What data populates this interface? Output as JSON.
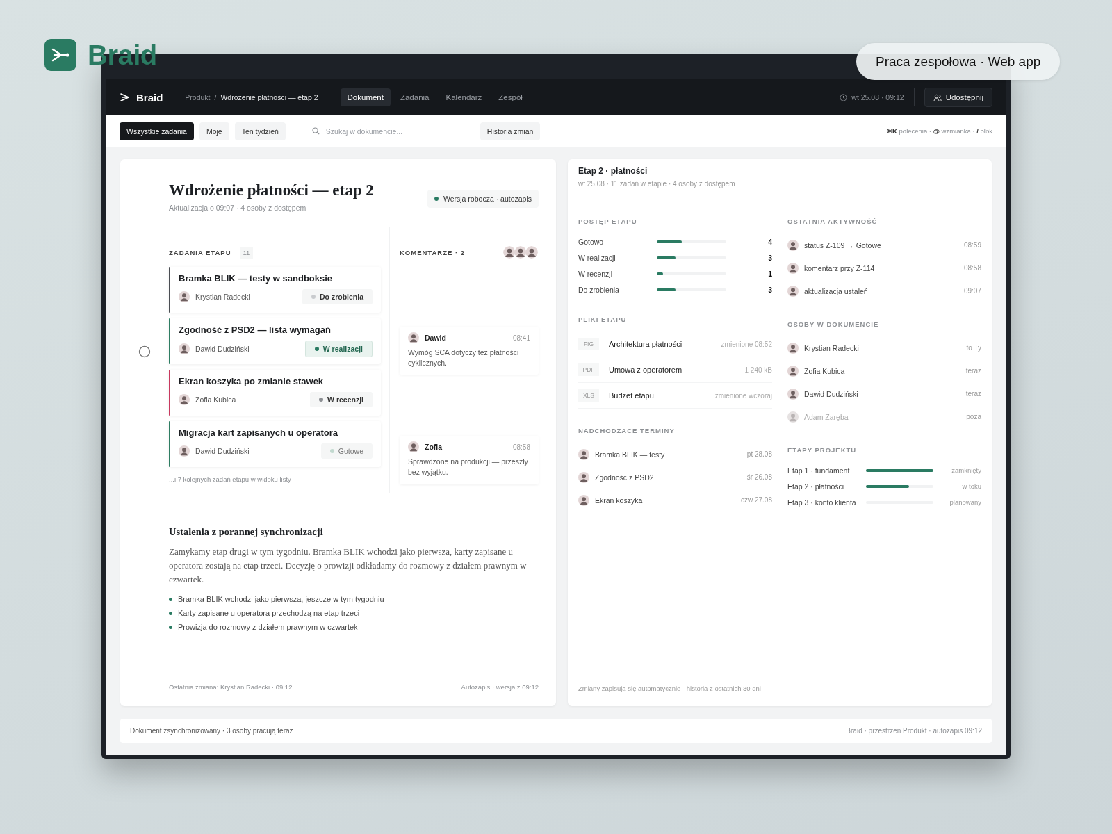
{
  "brand": {
    "name": "Braid"
  },
  "badge": "Praca zespołowa · Web app",
  "nav": {
    "logo": "Braid",
    "breadcrumb": [
      "Produkt",
      "Wdrożenie płatności — etap 2"
    ],
    "breadcrumb_separator": "/",
    "tabs": [
      {
        "label": "Dokument",
        "selected": true
      },
      {
        "label": "Zadania",
        "selected": false
      },
      {
        "label": "Kalendarz",
        "selected": false
      },
      {
        "label": "Zespół",
        "selected": false
      }
    ],
    "datetime": "wt 25.08 · 09:12",
    "share_button": "Udostępnij"
  },
  "toolbar": {
    "filters": [
      {
        "label": "Wszystkie zadania",
        "selected": true
      },
      {
        "label": "Moje",
        "selected": false
      },
      {
        "label": "Ten tydzień",
        "selected": false
      }
    ],
    "search": {
      "placeholder": "Szukaj w dokumencie..."
    },
    "history_button": "Historia zmian",
    "shortcuts": "**⌘K** polecenia · **@** wzmianka · **/** blok"
  },
  "document": {
    "title": "Wdrożenie płatności — etap 2",
    "meta": "Aktualizacja o 09:07 · 4 osoby z dostępem",
    "status": "Wersja robocza · autozapis",
    "tasks_heading": "ZADANIA ETAPU",
    "tasks_count": "11",
    "tasks": [
      {
        "title": "Bramka BLIK — testy w sandboksie",
        "assignee": "Krystian Radecki",
        "color": "#4a4d52",
        "status": {
          "label": "Do zrobienia",
          "kind": "todo"
        }
      },
      {
        "title": "Zgodność z PSD2 — lista wymagań",
        "assignee": "Dawid Dudziński",
        "color": "#2e7d62",
        "status": {
          "label": "W realizacji",
          "kind": "progress"
        }
      },
      {
        "title": "Ekran koszyka po zmianie stawek",
        "assignee": "Zofia Kubica",
        "color": "#c8385e",
        "status": {
          "label": "W recenzji",
          "kind": "review"
        }
      },
      {
        "title": "Migracja kart zapisanych u operatora",
        "assignee": "Dawid Dudziński",
        "color": "#2e7d62",
        "status": {
          "label": "Gotowe",
          "kind": "done"
        }
      }
    ],
    "tasks_more": "...i 7 kolejnych zadań etapu w widoku listy",
    "comments_heading": "KOMENTARZE · 2",
    "comments": [
      {
        "author": "Dawid",
        "time": "08:41",
        "text": "Wymóg SCA dotyczy też płatności cyklicznych."
      },
      {
        "author": "Zofia",
        "time": "08:58",
        "text": "Sprawdzone na produkcji — przeszły bez wyjątku."
      }
    ],
    "notes_heading": "Ustalenia z porannej synchronizacji",
    "notes_text": "Zamykamy etap drugi w tym tygodniu. Bramka BLIK wchodzi jako pierwsza, karty zapisane u operatora zostają na etap trzeci. Decyzję o prowizji odkładamy do rozmowy z działem prawnym w czwartek.",
    "notes_bullets": [
      "Bramka BLIK wchodzi jako pierwsza, jeszcze w tym tygodniu",
      "Karty zapisane u operatora przechodzą na etap trzeci",
      "Prowizja do rozmowy z działem prawnym w czwartek"
    ],
    "footer_left": "Ostatnia zmiana: Krystian Radecki · 09:12",
    "footer_right": "Autozapis · wersja z 09:12"
  },
  "panel": {
    "title": "Etap 2 · płatności",
    "meta": "wt 25.08 · 11 zadań w etapie · 4 osoby z dostępem",
    "progress_heading": "POSTĘP ETAPU",
    "progress": [
      {
        "label": "Gotowo",
        "level": 0.36,
        "count": "4"
      },
      {
        "label": "W realizacji",
        "level": 0.27,
        "count": "3"
      },
      {
        "label": "W recenzji",
        "level": 0.09,
        "count": "1"
      },
      {
        "label": "Do zrobienia",
        "level": 0.27,
        "count": "3"
      }
    ],
    "files_heading": "PLIKI ETAPU",
    "files": [
      {
        "type": "FIG",
        "name": "Architektura płatności",
        "meta": "zmienione 08:52"
      },
      {
        "type": "PDF",
        "name": "Umowa z operatorem",
        "meta": "1 240 kB"
      },
      {
        "type": "XLS",
        "name": "Budżet etapu",
        "meta": "zmienione wczoraj"
      }
    ],
    "deadlines_heading": "NADCHODZĄCE TERMINY",
    "deadlines": [
      {
        "task": "Bramka BLIK — testy",
        "date": "pt 28.08"
      },
      {
        "task": "Zgodność z PSD2",
        "date": "śr 26.08"
      },
      {
        "task": "Ekran koszyka",
        "date": "czw 27.08"
      }
    ],
    "activity_heading": "OSTATNIA AKTYWNOŚĆ",
    "activity": [
      {
        "text": "status Z-109 → Gotowe",
        "time": "08:59"
      },
      {
        "text": "komentarz przy Z-114",
        "time": "08:58"
      },
      {
        "text": "aktualizacja ustaleń",
        "time": "09:07"
      }
    ],
    "people_heading": "OSOBY W DOKUMENCIE",
    "people": [
      {
        "name": "Krystian Radecki",
        "presence": "to Ty",
        "present": true
      },
      {
        "name": "Zofia Kubica",
        "presence": "teraz",
        "present": true
      },
      {
        "name": "Dawid Dudziński",
        "presence": "teraz",
        "present": true
      },
      {
        "name": "Adam Zaręba",
        "presence": "poza",
        "present": false
      }
    ],
    "stages_heading": "ETAPY PROJEKTU",
    "stages": [
      {
        "label": "Etap 1 · fundament",
        "level": 1,
        "state": "zamknięty"
      },
      {
        "label": "Etap 2 · płatności",
        "level": 0.64,
        "state": "w toku"
      },
      {
        "label": "Etap 3 · konto klienta",
        "level": 0,
        "state": "planowany"
      }
    ],
    "footer": "Zmiany zapisują się automatycznie · historia z ostatnich 30 dni"
  },
  "status_bar": {
    "left": "Dokument zsynchronizowany · 3 osoby pracują teraz",
    "right": "Braid · przestrzeń Produkt · autozapis 09:12"
  }
}
